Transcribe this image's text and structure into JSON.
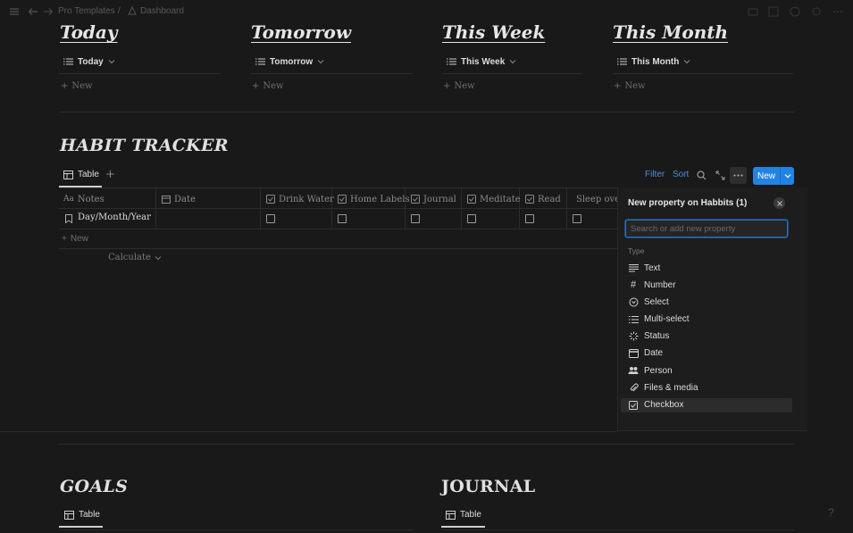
{
  "breadcrumb": {
    "workspace": "Pro Templates",
    "separator": "/",
    "page": "Dashboard"
  },
  "periods": [
    {
      "title": "Today",
      "view": "Today",
      "new_label": "New"
    },
    {
      "title": "Tomorrow",
      "view": "Tomorrow",
      "new_label": "New"
    },
    {
      "title": "This Week",
      "view": "This Week",
      "new_label": "New"
    },
    {
      "title": "This Month",
      "view": "This Month",
      "new_label": "New"
    }
  ],
  "habit": {
    "title": "HABIT TRACKER",
    "tab": "Table",
    "toolbar": {
      "filter": "Filter",
      "sort": "Sort",
      "new": "New"
    },
    "columns": [
      "Notes",
      "Date",
      "Drink Water",
      "Home Labels",
      "Journal",
      "Meditate",
      "Read",
      "Sleep over"
    ],
    "row": {
      "notes": "Day/Month/Year"
    },
    "new_row": "New",
    "calculate": "Calculate"
  },
  "popup": {
    "title": "New property on Habbits (1)",
    "search_placeholder": "Search or add new property",
    "type_label": "Type",
    "types": [
      {
        "label": "Text",
        "icon": "text-lines-icon"
      },
      {
        "label": "Number",
        "icon": "hash-icon"
      },
      {
        "label": "Select",
        "icon": "select-circle-icon"
      },
      {
        "label": "Multi-select",
        "icon": "list-icon"
      },
      {
        "label": "Status",
        "icon": "status-spinner-icon"
      },
      {
        "label": "Date",
        "icon": "calendar-icon"
      },
      {
        "label": "Person",
        "icon": "people-icon"
      },
      {
        "label": "Files & media",
        "icon": "paperclip-icon"
      },
      {
        "label": "Checkbox",
        "icon": "checkbox-icon"
      }
    ],
    "selected": "Checkbox"
  },
  "goals": {
    "title": "GOALS",
    "tab": "Table"
  },
  "journal": {
    "title": "JOURNAL",
    "tab": "Table"
  },
  "help": "?"
}
